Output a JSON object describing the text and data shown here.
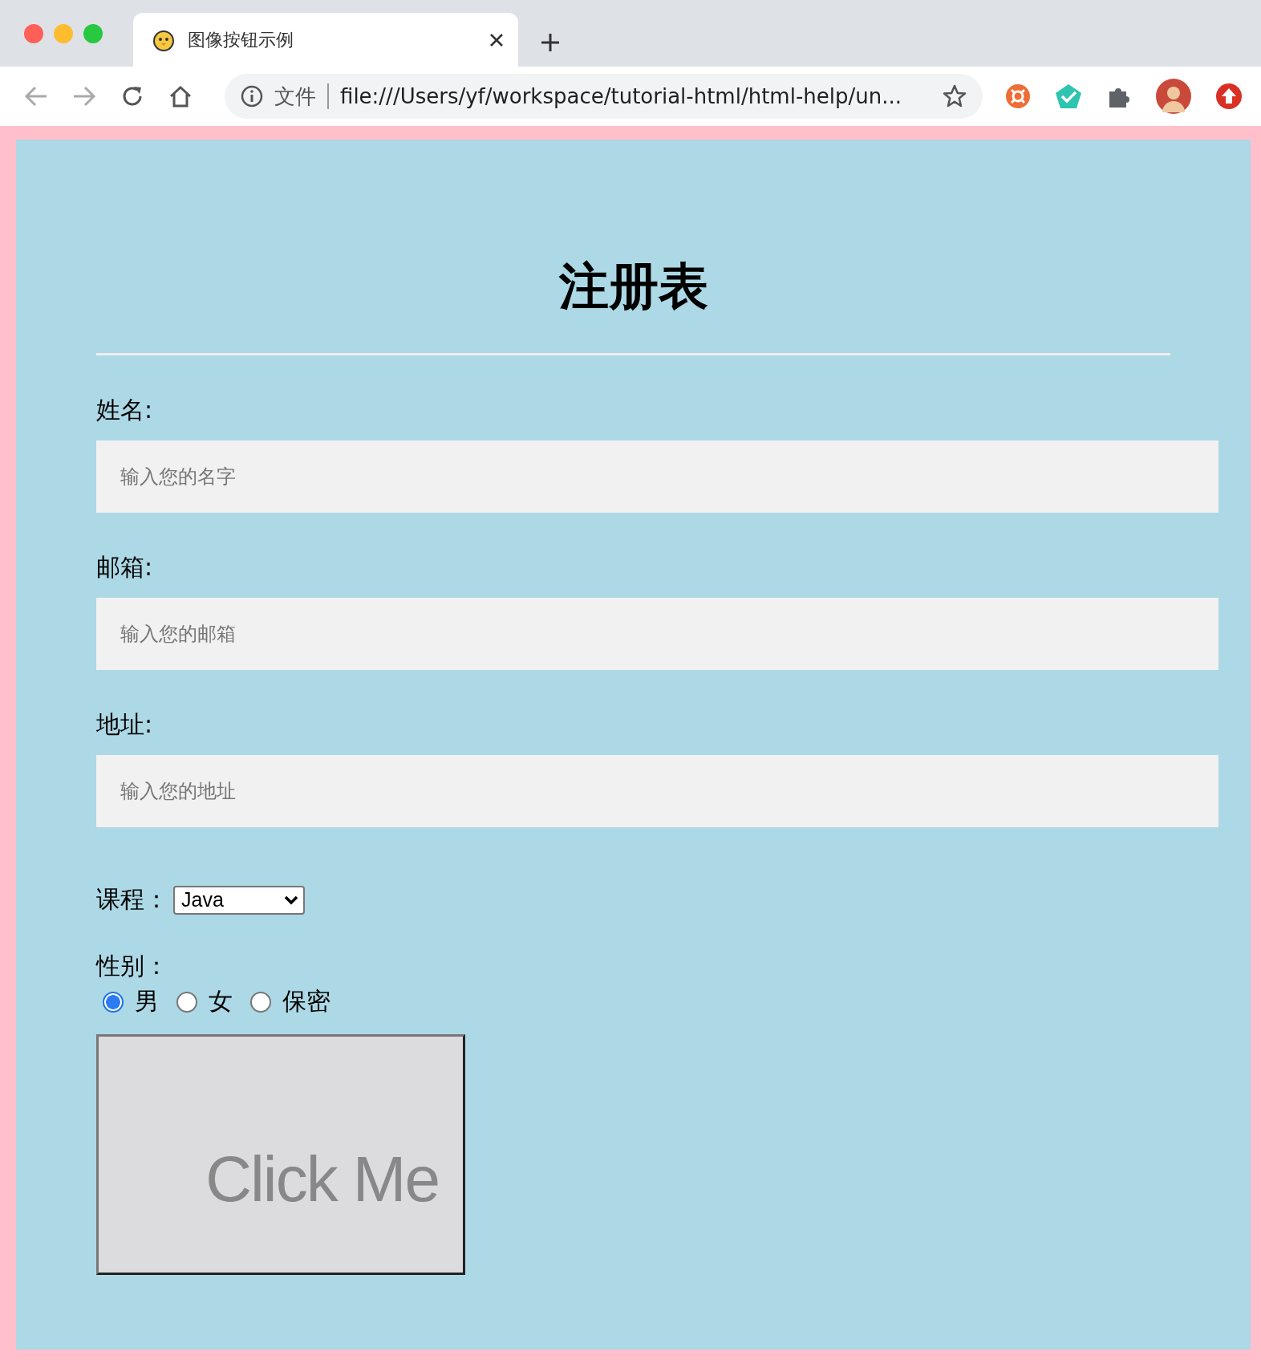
{
  "browser": {
    "tab": {
      "title": "图像按钮示例",
      "selected": true
    },
    "address": {
      "scheme_label": "文件",
      "url": "file:///Users/yf/workspace/tutorial-html/html-help/un..."
    }
  },
  "form": {
    "title": "注册表",
    "fields": [
      {
        "label": "姓名:",
        "placeholder": "输入您的名字"
      },
      {
        "label": "邮箱:",
        "placeholder": "输入您的邮箱"
      },
      {
        "label": "地址:",
        "placeholder": "输入您的地址"
      }
    ],
    "course": {
      "label": "课程：",
      "value": "Java"
    },
    "gender": {
      "label": "性别：",
      "options": [
        {
          "label": "男",
          "selected": true
        },
        {
          "label": "女",
          "selected": false
        },
        {
          "label": "保密",
          "selected": false
        }
      ]
    },
    "image_button": {
      "label": "Click Me"
    }
  }
}
